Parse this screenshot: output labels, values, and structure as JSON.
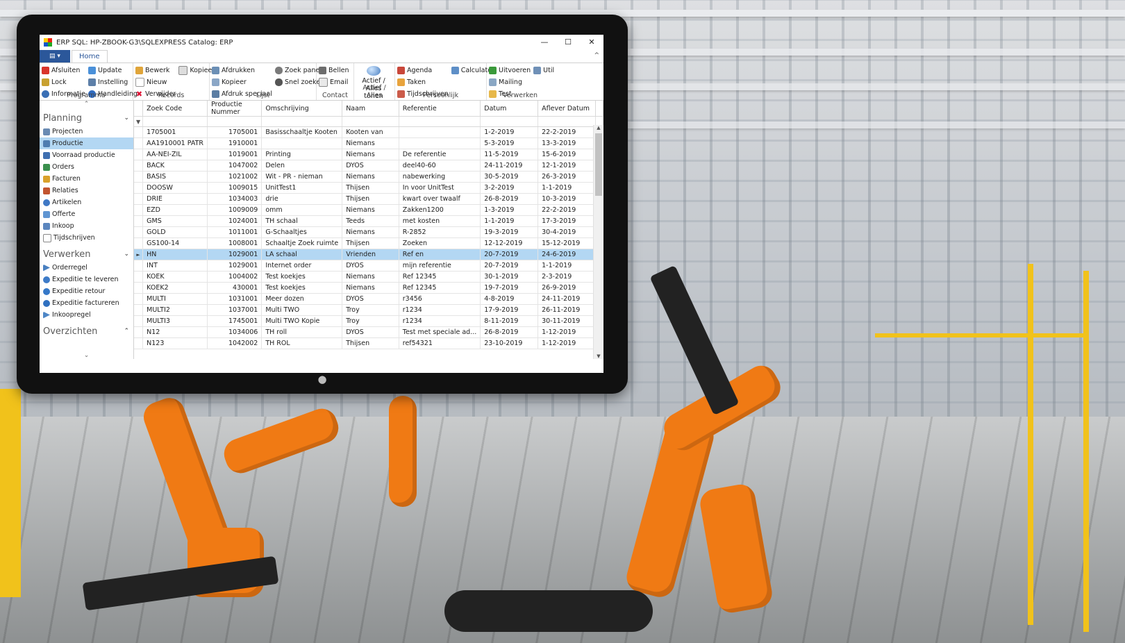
{
  "window": {
    "title": "ERP SQL: HP-ZBOOK-G3\\SQLEXPRESS  Catalog: ERP",
    "minimize": "—",
    "maximize": "☐",
    "close": "✕"
  },
  "ribbon": {
    "file_label": "▤ ▾",
    "home_tab": "Home",
    "collapse": "^",
    "groups": {
      "programma": {
        "label": "Programma",
        "items": [
          "Afsluiten",
          "Lock",
          "Informatie",
          "Update",
          "Instelling",
          "Handleiding"
        ]
      },
      "records": {
        "label": "Records",
        "items": [
          "Bewerk",
          "Nieuw",
          "Verwijder",
          "Kopieer"
        ]
      },
      "lijst": {
        "label": "Lijst",
        "items": [
          "Afdrukken",
          "Kopieer",
          "Afdruk speciaal",
          "Zoek paneel",
          "Snel zoeken"
        ]
      },
      "contact": {
        "label": "Contact",
        "items": [
          "Bellen",
          "Email"
        ]
      },
      "actief": {
        "label": "Actief / Alles",
        "button": "Actief / Alles tonen"
      },
      "persoonlijk": {
        "label": "Persoonlijk",
        "items": [
          "Agenda",
          "Taken",
          "Tijdschrijven",
          "Calculator"
        ]
      },
      "verwerken": {
        "label": "Verwerken",
        "items": [
          "Uitvoeren",
          "Mailing",
          "Test",
          "Util"
        ]
      }
    }
  },
  "nav": {
    "up": "⌃",
    "down": "⌄",
    "sections": [
      {
        "title": "Planning",
        "chevron": "⌄",
        "items": [
          "Projecten",
          "Productie",
          "Voorraad productie",
          "Orders",
          "Facturen",
          "Relaties",
          "Artikelen",
          "Offerte",
          "Inkoop",
          "Tijdschrijven"
        ]
      },
      {
        "title": "Verwerken",
        "chevron": "⌄",
        "items": [
          "Orderregel",
          "Expeditie te leveren",
          "Expeditie retour",
          "Expeditie factureren",
          "Inkoopregel"
        ]
      },
      {
        "title": "Overzichten",
        "chevron": "⌃",
        "items": []
      }
    ],
    "selected": "Productie"
  },
  "grid": {
    "columns": [
      "Zoek Code",
      "Productie Nummer",
      "Omschrijving",
      "Naam",
      "Referentie",
      "Datum",
      "Aflever Datum"
    ],
    "filter_icon": "▼",
    "current_row_marker": "►",
    "selected_index": 11,
    "rows": [
      [
        "1705001",
        "1705001",
        "Basisschaaltje Kooten",
        "Kooten van",
        "",
        "1-2-2019",
        "22-2-2019"
      ],
      [
        "AA1910001 PATR",
        "1910001",
        "",
        "Niemans",
        "",
        "5-3-2019",
        "13-3-2019"
      ],
      [
        "AA-NEI-ZIL",
        "1019001",
        "Printing",
        "Niemans",
        "De referentie",
        "11-5-2019",
        "15-6-2019"
      ],
      [
        "BACK",
        "1047002",
        "Delen",
        "DYOS",
        "deel40-60",
        "24-11-2019",
        "12-1-2019"
      ],
      [
        "BASIS",
        "1021002",
        "Wit - PR - nieman",
        "Niemans",
        "nabewerking",
        "30-5-2019",
        "26-3-2019"
      ],
      [
        "DOOSW",
        "1009015",
        "UnitTest1",
        "Thijsen",
        "In voor UnitTest",
        "3-2-2019",
        "1-1-2019"
      ],
      [
        "DRIE",
        "1034003",
        "drie",
        "Thijsen",
        "kwart over twaalf",
        "26-8-2019",
        "10-3-2019"
      ],
      [
        "EZD",
        "1009009",
        "omm",
        "Niemans",
        "Zakken1200",
        "1-3-2019",
        "22-2-2019"
      ],
      [
        "GMS",
        "1024001",
        "TH schaal",
        "Teeds",
        "met kosten",
        "1-1-2019",
        "17-3-2019"
      ],
      [
        "GOLD",
        "1011001",
        "G-Schaaltjes",
        "Niemans",
        "R-2852",
        "19-3-2019",
        "30-4-2019"
      ],
      [
        "GS100-14",
        "1008001",
        "Schaaltje Zoek ruimte",
        "Thijsen",
        "Zoeken",
        "12-12-2019",
        "15-12-2019"
      ],
      [
        "HN",
        "1029001",
        "LA schaal",
        "Vrienden",
        "Ref en",
        "20-7-2019",
        "24-6-2019"
      ],
      [
        "INT",
        "1029001",
        "Internet order",
        "DYOS",
        "mijn referentie",
        "20-7-2019",
        "1-1-2019"
      ],
      [
        "KOEK",
        "1004002",
        "Test koekjes",
        "Niemans",
        "Ref 12345",
        "30-1-2019",
        "2-3-2019"
      ],
      [
        "KOEK2",
        "430001",
        "Test koekjes",
        "Niemans",
        "Ref 12345",
        "19-7-2019",
        "26-9-2019"
      ],
      [
        "MULTI",
        "1031001",
        "Meer dozen",
        "DYOS",
        "r3456",
        "4-8-2019",
        "24-11-2019"
      ],
      [
        "MULTI2",
        "1037001",
        "Multi TWO",
        "Troy",
        "r1234",
        "17-9-2019",
        "26-11-2019"
      ],
      [
        "MULTI3",
        "1745001",
        "Multi TWO Kopie",
        "Troy",
        "r1234",
        "8-11-2019",
        "30-11-2019"
      ],
      [
        "N12",
        "1034006",
        "TH roll",
        "DYOS",
        "Test met speciale ad...",
        "26-8-2019",
        "1-12-2019"
      ],
      [
        "N123",
        "1042002",
        "TH ROL",
        "Thijsen",
        "ref54321",
        "23-10-2019",
        "1-12-2019"
      ]
    ]
  },
  "colors": {
    "accent": "#2b579a",
    "selection": "#b3d7f3"
  }
}
